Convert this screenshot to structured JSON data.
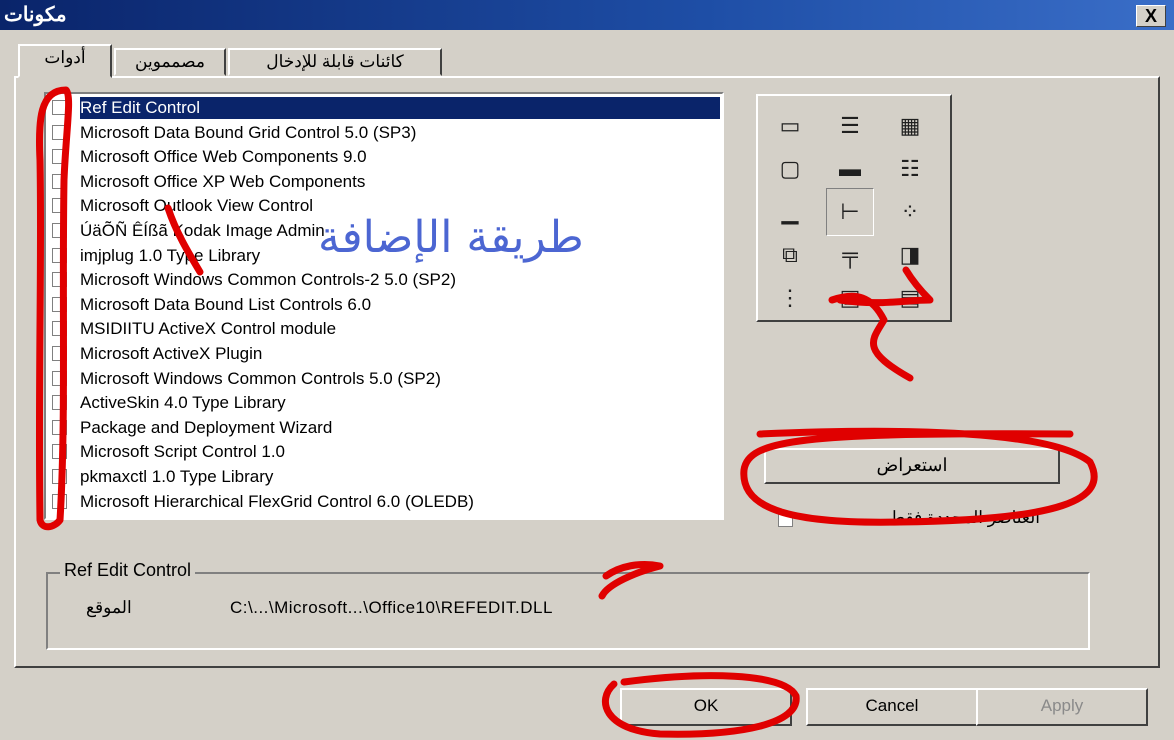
{
  "window": {
    "title": "مكونات",
    "close_label": "X"
  },
  "tabs": [
    {
      "label": "أدوات",
      "active": true
    },
    {
      "label": "مصمموين",
      "active": false
    },
    {
      "label": "كائنات قابلة للإدخال",
      "active": false
    }
  ],
  "controls_list": [
    {
      "label": "Ref Edit Control",
      "checked": false,
      "selected": true
    },
    {
      "label": "Microsoft Data Bound Grid Control 5.0 (SP3)",
      "checked": false
    },
    {
      "label": "Microsoft Office Web Components 9.0",
      "checked": false
    },
    {
      "label": "Microsoft Office XP Web Components",
      "checked": false
    },
    {
      "label": "Microsoft Outlook View Control",
      "checked": false
    },
    {
      "label": "ÚäÕÑ ÊÍßã Kodak Image Admin",
      "checked": false
    },
    {
      "label": "imjplug 1.0 Type Library",
      "checked": false
    },
    {
      "label": "Microsoft Windows Common Controls-2 5.0 (SP2)",
      "checked": false
    },
    {
      "label": "Microsoft Data Bound List Controls 6.0",
      "checked": false
    },
    {
      "label": "MSIDIITU ActiveX Control module",
      "checked": false
    },
    {
      "label": "Microsoft ActiveX Plugin",
      "checked": false
    },
    {
      "label": "Microsoft Windows Common Controls 5.0 (SP2)",
      "checked": false
    },
    {
      "label": "ActiveSkin 4.0 Type Library",
      "checked": false
    },
    {
      "label": "Package and Deployment Wizard",
      "checked": false
    },
    {
      "label": "Microsoft Script Control 1.0",
      "checked": false
    },
    {
      "label": "pkmaxctl 1.0 Type Library",
      "checked": false
    },
    {
      "label": "Microsoft Hierarchical FlexGrid Control 6.0 (OLEDB)",
      "checked": false
    }
  ],
  "toolbox_icons": [
    "palette-icon",
    "textbox-icon",
    "label-icon",
    "frame-icon",
    "commandbutton-icon",
    "listbox-icon",
    "scrollbar-icon",
    "treeview-icon",
    "optiongroup-icon",
    "tabstrip-icon",
    "toolbar-icon",
    "imagelist-icon",
    "grid-icon",
    "image-icon",
    "textedit-icon"
  ],
  "browse_button": {
    "label": "استعراض"
  },
  "selected_only": {
    "label": "العناصر المحددة فقط",
    "checked": false
  },
  "details": {
    "legend": "Ref Edit Control",
    "location_label": "الموقع",
    "location_value": "C:\\...\\Microsoft...\\Office10\\REFEDIT.DLL"
  },
  "buttons": {
    "ok": "OK",
    "cancel": "Cancel",
    "apply": "Apply"
  },
  "overlay": {
    "stamp_text": "طريقة الإضافة",
    "annotation_color": "#e00000",
    "stamp_color": "#2040c8"
  }
}
